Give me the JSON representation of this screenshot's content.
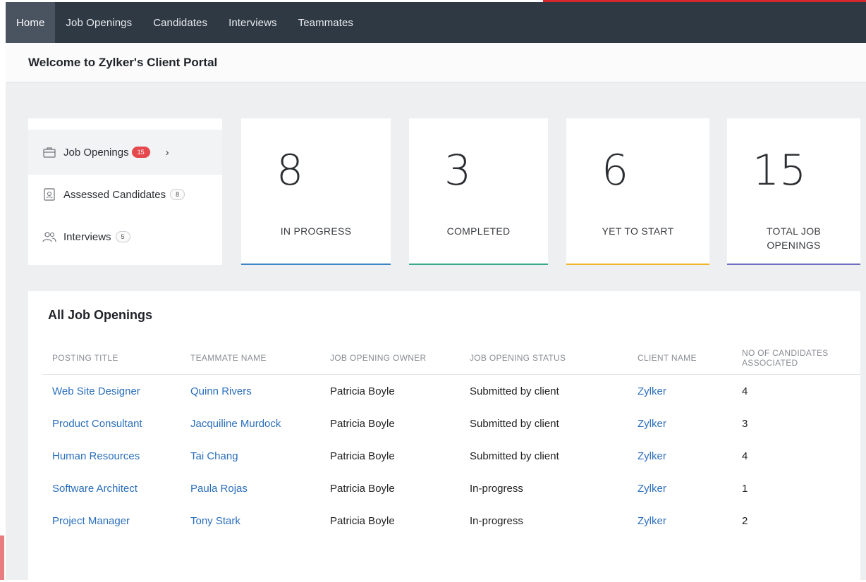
{
  "nav": {
    "items": [
      {
        "label": "Home",
        "active": true
      },
      {
        "label": "Job Openings",
        "active": false
      },
      {
        "label": "Candidates",
        "active": false
      },
      {
        "label": "Interviews",
        "active": false
      },
      {
        "label": "Teammates",
        "active": false
      }
    ]
  },
  "page_title": "Welcome to Zylker's Client Portal",
  "sidebar": {
    "items": [
      {
        "label": "Job Openings",
        "count": "15",
        "icon": "briefcase-icon",
        "active": true
      },
      {
        "label": "Assessed Candidates",
        "count": "8",
        "icon": "assessment-icon",
        "active": false
      },
      {
        "label": "Interviews",
        "count": "5",
        "icon": "people-icon",
        "active": false
      }
    ]
  },
  "stats": [
    {
      "value": "8",
      "label": "IN PROGRESS",
      "color": "#3d85c6"
    },
    {
      "value": "3",
      "label": "COMPLETED",
      "color": "#3aa88b"
    },
    {
      "value": "6",
      "label": "YET TO START",
      "color": "#f0b429"
    },
    {
      "value": "15",
      "label_line1": "TOTAL JOB",
      "label_line2": "OPENINGS",
      "color": "#6f6ec2"
    }
  ],
  "table": {
    "title": "All Job Openings",
    "headers": {
      "posting_title": "POSTING TITLE",
      "teammate_name": "TEAMMATE NAME",
      "owner": "JOB OPENING OWNER",
      "status": "JOB OPENING STATUS",
      "client": "CLIENT NAME",
      "candidates_line1": "NO OF CANDIDATES",
      "candidates_line2": "ASSOCIATED"
    },
    "rows": [
      {
        "title": "Web Site Designer",
        "teammate": "Quinn Rivers",
        "owner": "Patricia Boyle",
        "status": "Submitted by client",
        "client": "Zylker",
        "candidates": "4"
      },
      {
        "title": "Product Consultant",
        "teammate": "Jacquiline Murdock",
        "owner": "Patricia Boyle",
        "status": "Submitted by client",
        "client": "Zylker",
        "candidates": "3"
      },
      {
        "title": "Human Resources",
        "teammate": "Tai Chang",
        "owner": "Patricia Boyle",
        "status": "Submitted by client",
        "client": "Zylker",
        "candidates": "4"
      },
      {
        "title": "Software Architect",
        "teammate": "Paula Rojas",
        "owner": "Patricia Boyle",
        "status": "In-progress",
        "client": "Zylker",
        "candidates": "1"
      },
      {
        "title": "Project Manager",
        "teammate": "Tony Stark",
        "owner": "Patricia Boyle",
        "status": "In-progress",
        "client": "Zylker",
        "candidates": "2"
      }
    ]
  },
  "colors": {
    "nav_bg": "#2f3944",
    "brand_red": "#d7262c",
    "link": "#2a6ebb"
  }
}
